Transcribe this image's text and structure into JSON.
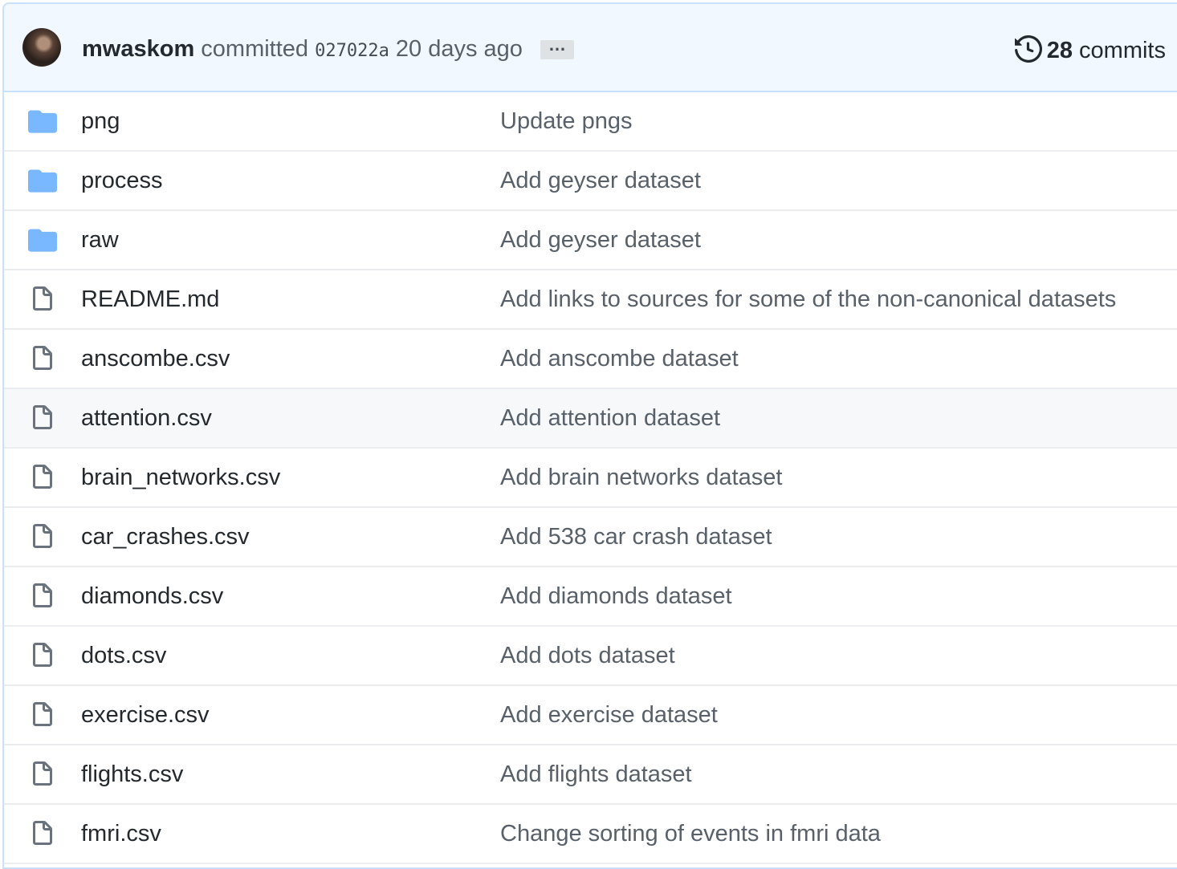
{
  "commit": {
    "author": "mwaskom",
    "verb": "committed",
    "sha": "027022a",
    "time": "20 days ago",
    "ellipsis": "…",
    "commit_count": "28",
    "commits_label": "commits"
  },
  "files": [
    {
      "name": "png",
      "type": "folder",
      "message": "Update pngs"
    },
    {
      "name": "process",
      "type": "folder",
      "message": "Add geyser dataset"
    },
    {
      "name": "raw",
      "type": "folder",
      "message": "Add geyser dataset"
    },
    {
      "name": "README.md",
      "type": "file",
      "message": "Add links to sources for some of the non-canonical datasets"
    },
    {
      "name": "anscombe.csv",
      "type": "file",
      "message": "Add anscombe dataset"
    },
    {
      "name": "attention.csv",
      "type": "file",
      "message": "Add attention dataset"
    },
    {
      "name": "brain_networks.csv",
      "type": "file",
      "message": "Add brain networks dataset"
    },
    {
      "name": "car_crashes.csv",
      "type": "file",
      "message": "Add 538 car crash dataset"
    },
    {
      "name": "diamonds.csv",
      "type": "file",
      "message": "Add diamonds dataset"
    },
    {
      "name": "dots.csv",
      "type": "file",
      "message": "Add dots dataset"
    },
    {
      "name": "exercise.csv",
      "type": "file",
      "message": "Add exercise dataset"
    },
    {
      "name": "flights.csv",
      "type": "file",
      "message": "Add flights dataset"
    },
    {
      "name": "fmri.csv",
      "type": "file",
      "message": "Change sorting of events in fmri data"
    }
  ],
  "colors": {
    "folder": "#79b8ff",
    "file_icon": "#6a737d",
    "header_bg": "#f1f8ff",
    "hover_row": "#f6f8fa"
  },
  "icons": {
    "folder": "folder-icon",
    "file": "file-icon",
    "history": "history-icon"
  }
}
